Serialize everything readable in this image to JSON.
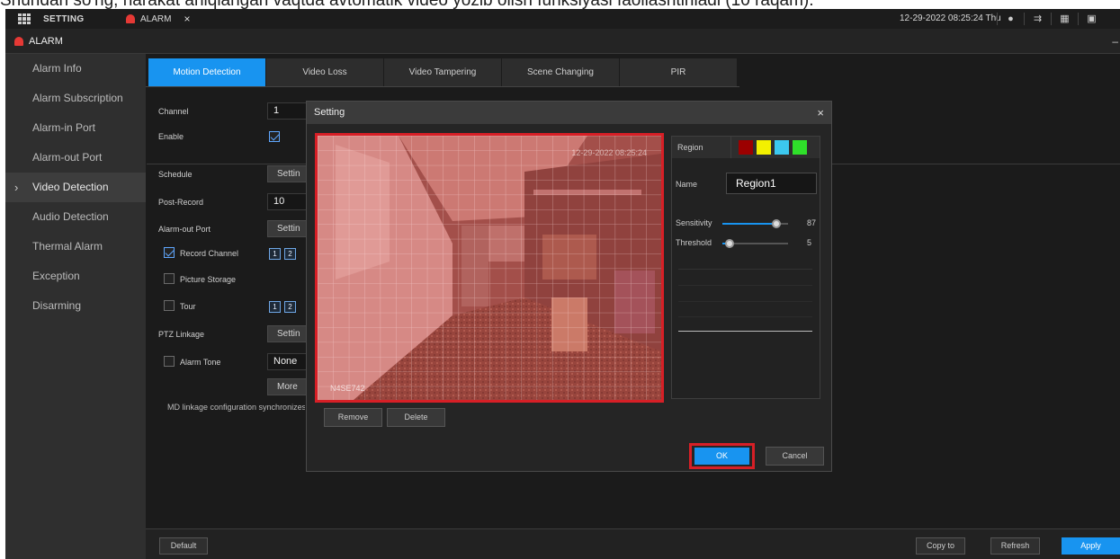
{
  "caption": "Shundan so'ng, harakat aniqlangan vaqtda avtomatik video yozib olish funksiyasi faollashtiriladi (10 raqam).",
  "topbar": {
    "setting_label": "SETTING",
    "alarm_tab_label": "ALARM",
    "close_glyph": "×",
    "datetime": "12-29-2022 08:25:24 Thu",
    "icons": [
      "user-icon",
      "logout-icon",
      "qr-code-icon",
      "screen-icon"
    ]
  },
  "page": {
    "title": "ALARM",
    "minimize_glyph": "–"
  },
  "sidebar": {
    "items": [
      {
        "label": "Alarm Info"
      },
      {
        "label": "Alarm Subscription"
      },
      {
        "label": "Alarm-in Port"
      },
      {
        "label": "Alarm-out Port"
      },
      {
        "label": "Video Detection",
        "active": true
      },
      {
        "label": "Audio Detection"
      },
      {
        "label": "Thermal Alarm"
      },
      {
        "label": "Exception"
      },
      {
        "label": "Disarming"
      }
    ],
    "arrow": "›"
  },
  "tabs": [
    {
      "label": "Motion Detection",
      "active": true
    },
    {
      "label": "Video Loss"
    },
    {
      "label": "Video Tampering"
    },
    {
      "label": "Scene Changing"
    },
    {
      "label": "PIR"
    }
  ],
  "form": {
    "channel_label": "Channel",
    "channel_value": "1",
    "enable_label": "Enable",
    "enable_checked": true,
    "schedule_label": "Schedule",
    "schedule_button": "Settin",
    "post_record_label": "Post-Record",
    "post_record_value": "10",
    "alarm_out_label": "Alarm-out Port",
    "alarm_out_button": "Settin",
    "record_channel_label": "Record Channel",
    "record_channel_checked": true,
    "record_channels": [
      "1",
      "2"
    ],
    "picture_storage_label": "Picture Storage",
    "tour_label": "Tour",
    "tour_channels": [
      "1",
      "2"
    ],
    "ptz_label": "PTZ Linkage",
    "ptz_button": "Settin",
    "alarm_tone_label": "Alarm Tone",
    "alarm_tone_value": "None",
    "more_button": "More",
    "note": "MD linkage configuration synchronizes"
  },
  "bottom": {
    "default": "Default",
    "copy_to": "Copy to",
    "refresh": "Refresh",
    "apply": "Apply"
  },
  "dialog": {
    "title": "Setting",
    "close_glyph": "×",
    "watermark_tr": "12-29-2022 08:25:24",
    "watermark_bl": "N4SE742",
    "remove": "Remove",
    "delete": "Delete",
    "ok": "OK",
    "cancel": "Cancel",
    "region_label": "Region",
    "region_colors": [
      "#9c0000",
      "#f3f000",
      "#3cc8ef",
      "#2fe02a"
    ],
    "name_label": "Name",
    "name_value": "Region1",
    "sensitivity_label": "Sensitivity",
    "sensitivity_value": "87",
    "sensitivity_fraction": 0.87,
    "threshold_label": "Threshold",
    "threshold_value": "5",
    "threshold_fraction": 0.05
  },
  "colors": {
    "accent": "#1894f0",
    "highlight": "#d71f26"
  }
}
